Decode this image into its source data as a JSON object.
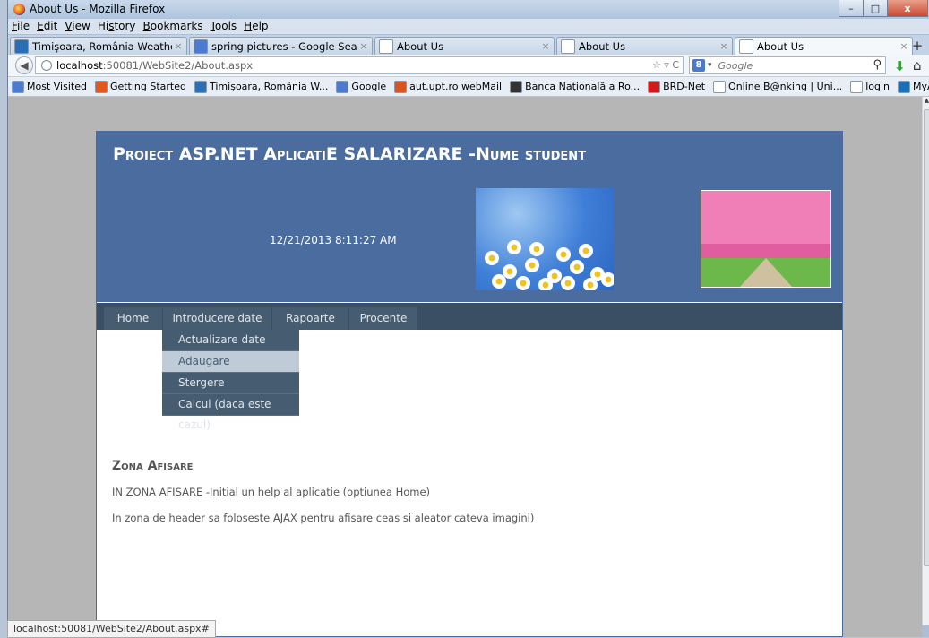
{
  "window": {
    "title": "About Us - Mozilla Firefox",
    "controls": {
      "minimize": "–",
      "maximize": "□",
      "close": "x"
    }
  },
  "menubar": {
    "items": [
      {
        "accel": "F",
        "rest": "ile"
      },
      {
        "accel": "E",
        "rest": "dit"
      },
      {
        "accel": "V",
        "rest": "iew"
      },
      {
        "pre": "Hi",
        "accel": "s",
        "rest": "tory"
      },
      {
        "accel": "B",
        "rest": "ookmarks"
      },
      {
        "accel": "T",
        "rest": "ools"
      },
      {
        "accel": "H",
        "rest": "elp"
      }
    ]
  },
  "tabs": [
    {
      "label": "Timişoara, România Weather Fore...",
      "icon_color": "#2a6fb5",
      "active": false
    },
    {
      "label": "spring pictures - Google Search",
      "icon_color": "#4a7bd0",
      "active": false
    },
    {
      "label": "About Us",
      "icon_color": "#ffffff",
      "active": false
    },
    {
      "label": "About Us",
      "icon_color": "#ffffff",
      "active": false
    },
    {
      "label": "About Us",
      "icon_color": "#ffffff",
      "active": true
    }
  ],
  "tab_close_glyph": "×",
  "new_tab_glyph": "+",
  "navigation": {
    "url_host": "localhost",
    "url_path": ":50081/WebSite2/About.aspx",
    "url_controls": "☆ ▿ C",
    "search_placeholder": "Google",
    "search_engine_letter": "8"
  },
  "bookmarks": [
    {
      "label": "Most Visited",
      "icon_color": "#4a7bd0"
    },
    {
      "label": "Getting Started",
      "icon_color": "#e5571b"
    },
    {
      "label": "Timişoara, România W...",
      "icon_color": "#2a6fb5"
    },
    {
      "label": "Google",
      "icon_color": "#4a7bd0"
    },
    {
      "label": "aut.upt.ro webMail",
      "icon_color": "#d9541e"
    },
    {
      "label": "Banca Naţională a Ro...",
      "icon_color": "#333333"
    },
    {
      "label": "BRD-Net",
      "icon_color": "#d21a1a"
    },
    {
      "label": "Online B@nking | Uni...",
      "icon_color": "#ffffff"
    },
    {
      "label": "login",
      "icon_color": "#ffffff"
    },
    {
      "label": "MyAccount :: Autentifi...",
      "icon_color": "#1b6fb8"
    }
  ],
  "site": {
    "title": "Proiect ASP.NET AplicatiE SALARIZARE -Nume student",
    "clock": "12/21/2013 8:11:27 AM",
    "menu": [
      "Home",
      "Introducere date",
      "Rapoarte",
      "Procente"
    ],
    "submenu": [
      {
        "label": "Actualizare date",
        "hover": false
      },
      {
        "label": "Adaugare",
        "hover": true
      },
      {
        "label": "Stergere",
        "hover": false
      },
      {
        "label": "Calcul (daca este cazul)",
        "hover": false
      }
    ],
    "section_title": "Zona Afisare",
    "paragraphs": [
      " IN ZONA AFISARE -Initial un help al aplicatie (optiunea Home)",
      "In zona de header sa foloseste AJAX pentru afisare ceas si aleator cateva imagini)"
    ]
  },
  "statusbar": {
    "text": "localhost:50081/WebSite2/About.aspx#"
  },
  "colors": {
    "header_bg": "#4b6c9e",
    "menu_bg": "#465c71",
    "menu_hover_bg": "#bfcbd6"
  }
}
